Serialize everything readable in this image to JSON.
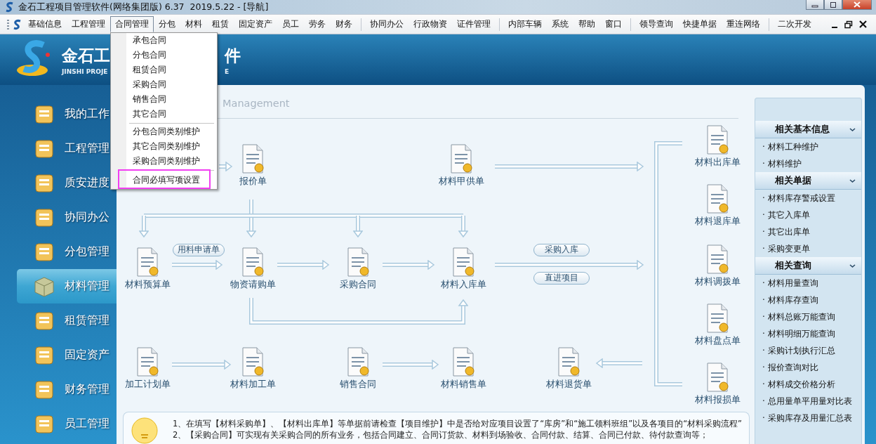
{
  "window": {
    "title": "金石工程项目管理软件(网络集团版) 6.37  2019.5.22 - [导航]"
  },
  "menu_bar": {
    "groups": [
      [
        {
          "label": "基础信息",
          "selected": false
        },
        {
          "label": "工程管理",
          "selected": false
        },
        {
          "label": "合同管理",
          "selected": true
        },
        {
          "label": "分包",
          "selected": false
        },
        {
          "label": "材料",
          "selected": false
        },
        {
          "label": "租赁",
          "selected": false
        },
        {
          "label": "固定资产",
          "selected": false
        },
        {
          "label": "员工",
          "selected": false
        },
        {
          "label": "劳务",
          "selected": false
        },
        {
          "label": "财务",
          "selected": false
        }
      ],
      [
        {
          "label": "协同办公",
          "selected": false
        },
        {
          "label": "行政物资",
          "selected": false
        },
        {
          "label": "证件管理",
          "selected": false
        }
      ],
      [
        {
          "label": "内部车辆",
          "selected": false
        },
        {
          "label": "系统",
          "selected": false
        },
        {
          "label": "帮助",
          "selected": false
        },
        {
          "label": "窗口",
          "selected": false
        }
      ],
      [
        {
          "label": "领导查询",
          "selected": false
        },
        {
          "label": "快捷单据",
          "selected": false
        },
        {
          "label": "重连网络",
          "selected": false
        }
      ],
      [
        {
          "label": "二次开发",
          "selected": false
        }
      ]
    ]
  },
  "dropdown": {
    "groups": [
      [
        {
          "label": "承包合同",
          "highlighted": false
        },
        {
          "label": "分包合同",
          "highlighted": false
        },
        {
          "label": "租赁合同",
          "highlighted": false
        },
        {
          "label": "采购合同",
          "highlighted": false
        },
        {
          "label": "销售合同",
          "highlighted": false
        },
        {
          "label": "其它合同",
          "highlighted": false
        }
      ],
      [
        {
          "label": "分包合同类别维护",
          "highlighted": false
        },
        {
          "label": "其它合同类别维护",
          "highlighted": false
        },
        {
          "label": "采购合同类别维护",
          "highlighted": false
        }
      ],
      [
        {
          "label": "合同必填写项设置",
          "highlighted": true
        }
      ]
    ]
  },
  "banner": {
    "title_parts": [
      "金石工",
      "件"
    ],
    "subtitle_parts": [
      "JINSHI PROJE",
      "E"
    ]
  },
  "sidebar": {
    "items": [
      {
        "label": "我的工作",
        "selected": false
      },
      {
        "label": "工程管理",
        "selected": false
      },
      {
        "label": "质安进度",
        "selected": false
      },
      {
        "label": "协同办公",
        "selected": false
      },
      {
        "label": "分包管理",
        "selected": false
      },
      {
        "label": "材料管理",
        "selected": true
      },
      {
        "label": "租赁管理",
        "selected": false
      },
      {
        "label": "固定资产",
        "selected": false
      },
      {
        "label": "财务管理",
        "selected": false
      },
      {
        "label": "员工管理",
        "selected": false
      }
    ]
  },
  "panel": {
    "title": "Management"
  },
  "flow": {
    "nodes": [
      "报价单",
      "材料甲供单",
      "材料出库单",
      "材料退库单",
      "材料预算单",
      "物资请购单",
      "采购合同",
      "材料入库单",
      "材料调拨单",
      "材料盘点单",
      "加工计划单",
      "材料加工单",
      "销售合同",
      "材料销售单",
      "材料退货单",
      "材料报损单"
    ],
    "tags": [
      "用料申请单",
      "采购入库",
      "直进项目"
    ]
  },
  "related": {
    "sections": [
      {
        "title": "相关基本信息",
        "expanded": true,
        "items": [
          "· 材料工种维护",
          "· 材料维护"
        ]
      },
      {
        "title": "相关单据",
        "expanded": true,
        "items": [
          "· 材料库存警戒设置",
          "· 其它入库单",
          "· 其它出库单",
          "· 采购变更单"
        ]
      },
      {
        "title": "相关查询",
        "expanded": true,
        "items": [
          "· 材料用量查询",
          "· 材料库存查询",
          "· 材料总账万能查询",
          "· 材料明细万能查询",
          "· 采购计划执行汇总",
          "· 报价查询对比",
          "· 材料成交价格分析",
          "· 总用量单平用量对比表",
          "· 采购库存及用量汇总表"
        ]
      }
    ]
  },
  "tips": {
    "lines": [
      "1、在填写【材料采购单】、【材料出库单】等单据前请检查【项目维护】中是否给对应项目设置了“库房”和“施工领料班组”以及各项目的“材料采购流程”",
      "2、【采购合同】可实现有关采购合同的所有业务，包括合同建立、合同订货款、材料到场验收、合同付款、结算、合同已付款、待付款查询等；"
    ]
  }
}
